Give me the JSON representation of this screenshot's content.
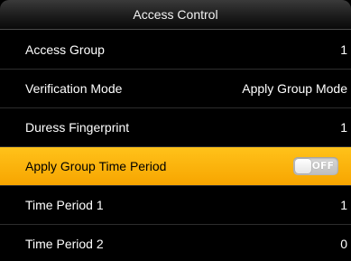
{
  "header": {
    "title": "Access Control"
  },
  "menu": {
    "items": [
      {
        "label": "Access Group",
        "value": "1"
      },
      {
        "label": "Verification Mode",
        "value": "Apply Group Mode"
      },
      {
        "label": "Duress Fingerprint",
        "value": "1"
      },
      {
        "label": "Apply Group Time Period",
        "toggle_state": "OFF",
        "selected": true
      },
      {
        "label": "Time Period 1",
        "value": "1"
      },
      {
        "label": "Time Period 2",
        "value": "0"
      }
    ]
  },
  "colors": {
    "selected_row": "#f7a500",
    "background": "#000000",
    "text": "#ffffff"
  }
}
